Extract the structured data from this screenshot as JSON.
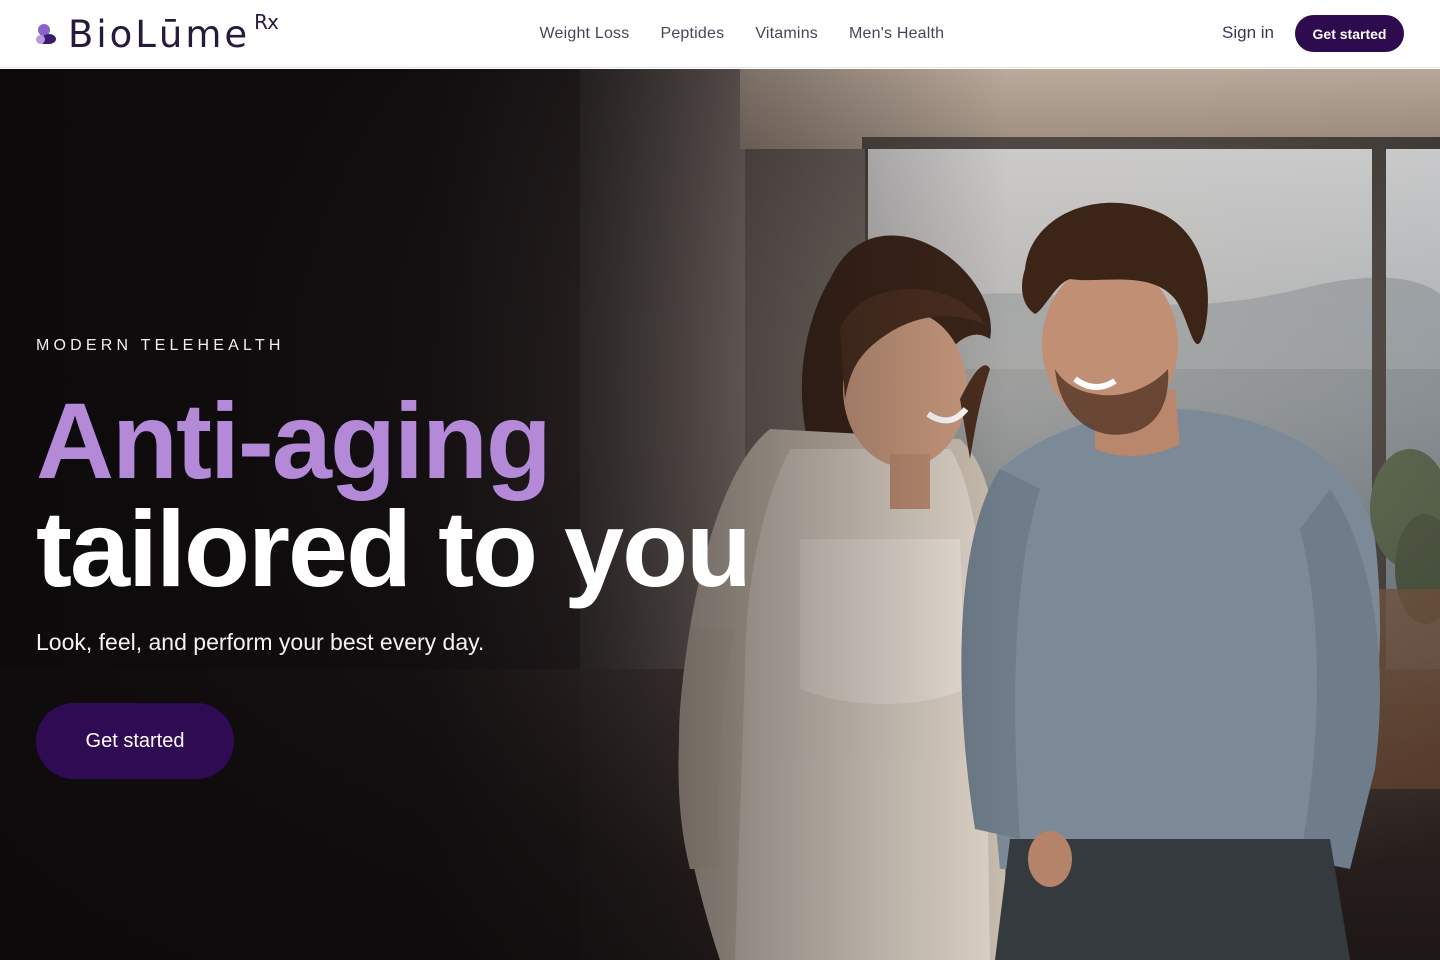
{
  "brand": {
    "name": "BioLūme",
    "suffix": "Rx",
    "colors": {
      "primary": "#2d0b4e",
      "accent": "#b48ad8",
      "logo_light": "#8b62c9"
    }
  },
  "nav": {
    "links": [
      {
        "label": "Weight Loss"
      },
      {
        "label": "Peptides"
      },
      {
        "label": "Vitamins"
      },
      {
        "label": "Men's Health"
      }
    ]
  },
  "header": {
    "sign_in": "Sign in",
    "cta": "Get started"
  },
  "hero": {
    "eyebrow": "MODERN TELEHEALTH",
    "headline_accent": "Anti-aging",
    "headline_main": "tailored to you",
    "subhead": "Look, feel, and perform your best every day.",
    "cta": "Get started",
    "image": "smiling couple walking in a bright living room with ocean view"
  }
}
